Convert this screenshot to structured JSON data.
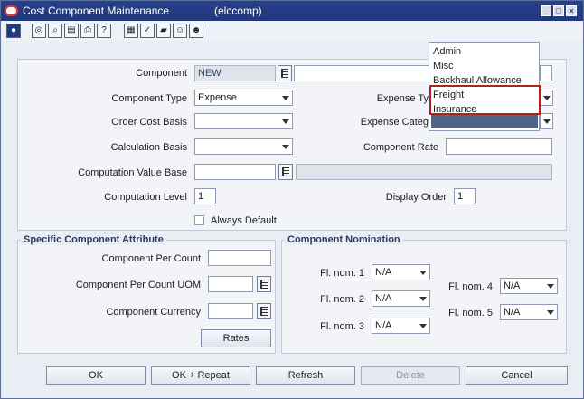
{
  "window": {
    "title": "Cost Component Maintenance",
    "context": "(elccomp)"
  },
  "toolbar": {
    "icons": [
      "globe-icon",
      "help-icon",
      "find-icon",
      "doc-icon",
      "print-icon",
      "question-icon",
      "grid-icon",
      "check-icon",
      "folder-icon",
      "user-icon",
      "user2-icon"
    ]
  },
  "form": {
    "component": {
      "label": "Component",
      "value": "NEW"
    },
    "component_type": {
      "label": "Component Type",
      "value": "Expense"
    },
    "expense_type": {
      "label": "Expense Ty"
    },
    "order_cost_basis": {
      "label": "Order Cost Basis",
      "value": ""
    },
    "expense_category": {
      "label": "Expense Categ"
    },
    "calculation_basis": {
      "label": "Calculation Basis",
      "value": ""
    },
    "component_rate": {
      "label": "Component Rate",
      "value": ""
    },
    "computation_value_base": {
      "label": "Computation Value Base",
      "value": ""
    },
    "computation_level": {
      "label": "Computation Level",
      "value": "1"
    },
    "display_order": {
      "label": "Display Order",
      "value": "1"
    },
    "always_default": {
      "label": "Always Default"
    }
  },
  "specific": {
    "title": "Specific Component Attribute",
    "per_count": {
      "label": "Component Per Count",
      "value": ""
    },
    "per_count_uom": {
      "label": "Component Per Count UOM",
      "value": ""
    },
    "currency": {
      "label": "Component Currency",
      "value": ""
    },
    "rates_button": "Rates"
  },
  "nomination": {
    "title": "Component Nomination",
    "fl1": {
      "label": "Fl. nom. 1",
      "value": "N/A"
    },
    "fl2": {
      "label": "Fl. nom. 2",
      "value": "N/A"
    },
    "fl3": {
      "label": "Fl. nom. 3",
      "value": "N/A"
    },
    "fl4": {
      "label": "Fl. nom. 4",
      "value": "N/A"
    },
    "fl5": {
      "label": "Fl. nom. 5",
      "value": "N/A"
    }
  },
  "dropdown": {
    "options": [
      "Admin",
      "Misc",
      "Backhaul Allowance",
      "Freight",
      "Insurance"
    ]
  },
  "buttons": {
    "ok": "OK",
    "ok_repeat": "OK + Repeat",
    "refresh": "Refresh",
    "delete": "Delete",
    "cancel": "Cancel"
  }
}
